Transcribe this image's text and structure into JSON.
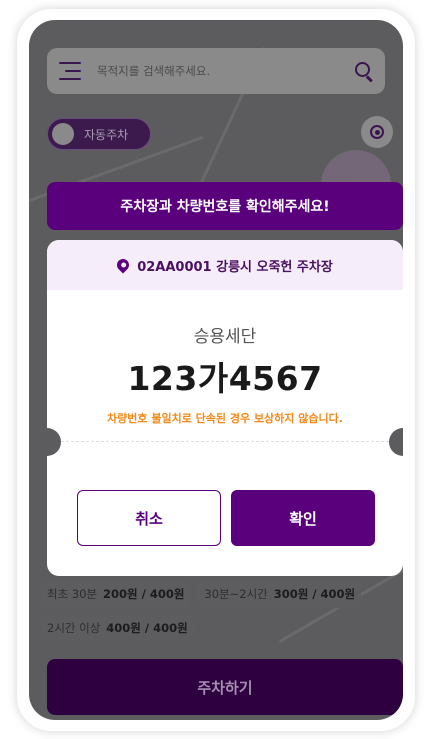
{
  "search": {
    "placeholder": "목적지를 검색해주세요."
  },
  "auto_parking": {
    "label": "자동주차"
  },
  "banner": {
    "text": "주차장과 차량번호를 확인해주세요!"
  },
  "modal": {
    "location": "02AA0001 강릉시 오죽헌 주차장",
    "car_type": "승용세단",
    "plate": "123가4567",
    "warning": "차량번호 불일치로 단속된 경우 보상하지 않습니다.",
    "cancel_label": "취소",
    "confirm_label": "확인"
  },
  "prices": [
    {
      "label": "최초 30분",
      "value": "200원 / 400원"
    },
    {
      "label": "30분~2시간",
      "value": "300원 / 400원"
    },
    {
      "label": "2시간 이상",
      "value": "400원 / 400원"
    }
  ],
  "park_button": {
    "label": "주차하기"
  },
  "colors": {
    "brand": "#5a007c",
    "warning": "#f28a1a"
  }
}
